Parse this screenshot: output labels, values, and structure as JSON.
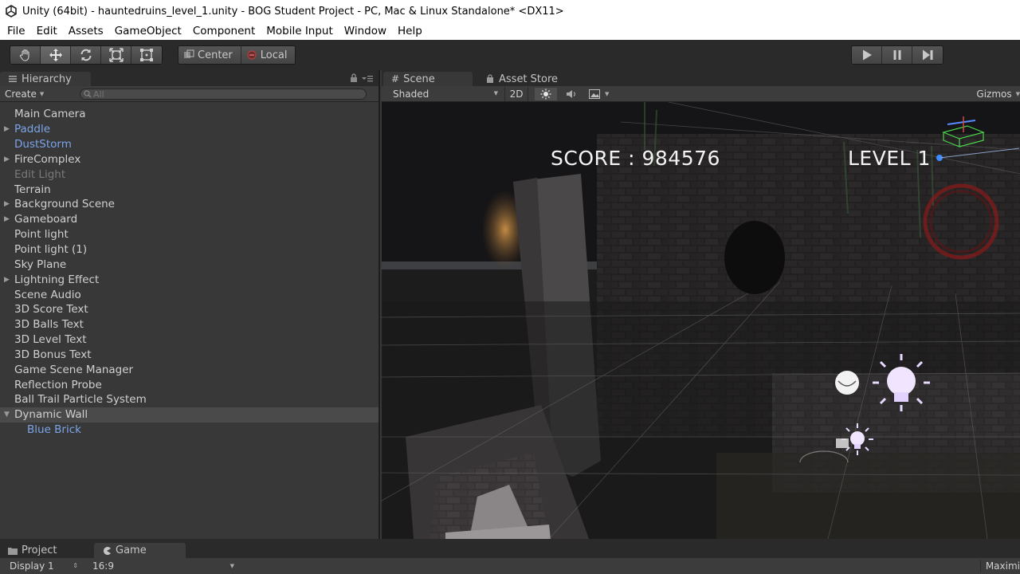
{
  "window": {
    "title": "Unity (64bit) - hauntedruins_level_1.unity - BOG Student Project - PC, Mac & Linux Standalone* <DX11>"
  },
  "menu": [
    "File",
    "Edit",
    "Assets",
    "GameObject",
    "Component",
    "Mobile Input",
    "Window",
    "Help"
  ],
  "toolbar": {
    "pivot_label": "Center",
    "space_label": "Local"
  },
  "hierarchy": {
    "tab_label": "Hierarchy",
    "create_label": "Create",
    "search_placeholder": "All",
    "items": [
      {
        "label": "Main Camera"
      },
      {
        "label": "Paddle"
      },
      {
        "label": "DustStorm"
      },
      {
        "label": "FireComplex"
      },
      {
        "label": "Edit Light"
      },
      {
        "label": "Terrain"
      },
      {
        "label": "Background Scene"
      },
      {
        "label": "Gameboard"
      },
      {
        "label": "Point light"
      },
      {
        "label": "Point light (1)"
      },
      {
        "label": "Sky Plane"
      },
      {
        "label": "Lightning Effect"
      },
      {
        "label": "Scene Audio"
      },
      {
        "label": "3D Score Text"
      },
      {
        "label": "3D Balls Text"
      },
      {
        "label": "3D Level Text"
      },
      {
        "label": "3D Bonus Text"
      },
      {
        "label": "Game Scene Manager"
      },
      {
        "label": "Reflection Probe"
      },
      {
        "label": "Ball Trail Particle System"
      },
      {
        "label": "Dynamic Wall"
      },
      {
        "label": "Blue Brick"
      }
    ]
  },
  "scene": {
    "tabs": [
      "Scene",
      "Asset Store"
    ],
    "shading_mode": "Shaded",
    "mode_2d": "2D",
    "gizmos_label": "Gizmos",
    "score_text": "SCORE : 984576",
    "level_text": "LEVEL 1"
  },
  "bottom": {
    "tabs": [
      "Project",
      "Game"
    ],
    "display_label": "Display 1",
    "aspect_label": "16:9",
    "maximize_label": "Maximi"
  },
  "colors": {
    "prefab_text": "#7ba4e8",
    "disabled_text": "#7a7a7a",
    "panel_bg": "#383838",
    "toolbar_bg": "#2a2a2a"
  }
}
